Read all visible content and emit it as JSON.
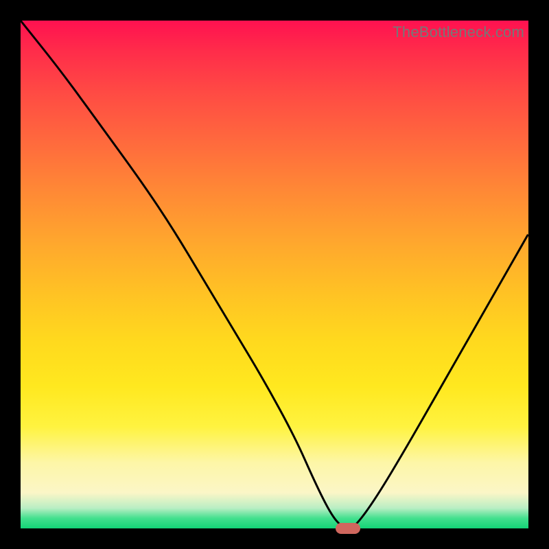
{
  "watermark": "TheBottleneck.com",
  "colors": {
    "frame": "#000000",
    "curve": "#000000",
    "marker": "#d0675e"
  },
  "chart_data": {
    "type": "line",
    "title": "",
    "xlabel": "",
    "ylabel": "",
    "xlim": [
      0,
      100
    ],
    "ylim": [
      0,
      100
    ],
    "x": [
      0,
      8,
      16,
      24,
      30,
      36,
      42,
      48,
      54,
      58,
      61,
      63,
      64.5,
      66,
      70,
      76,
      84,
      92,
      100
    ],
    "values": [
      100,
      90,
      79,
      68,
      59,
      49,
      39,
      29,
      18,
      9,
      3,
      0.5,
      0,
      0.5,
      6,
      16,
      30,
      44,
      58
    ],
    "marker": {
      "x": 64.5,
      "y": 0
    },
    "gradient_stops": [
      {
        "pct": 0,
        "hex": "#ff1150"
      },
      {
        "pct": 24,
        "hex": "#ff6a3d"
      },
      {
        "pct": 54,
        "hex": "#ffc324"
      },
      {
        "pct": 80,
        "hex": "#fff340"
      },
      {
        "pct": 93,
        "hex": "#fbf6c7"
      },
      {
        "pct": 100,
        "hex": "#13d477"
      }
    ]
  }
}
